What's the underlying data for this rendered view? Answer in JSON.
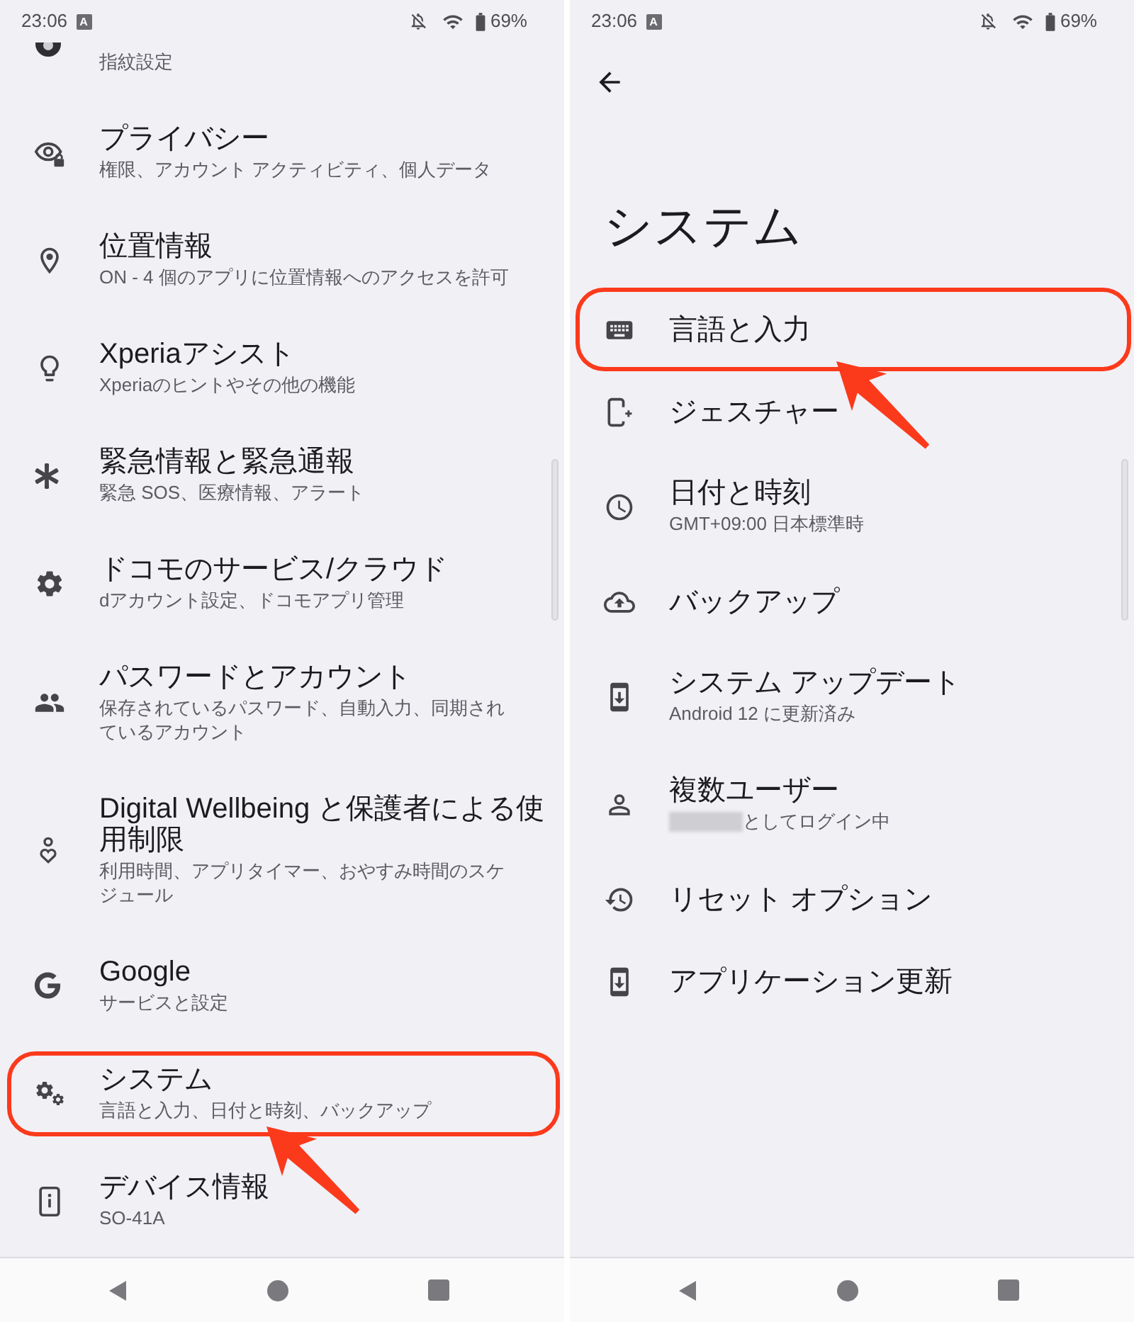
{
  "screens": [
    {
      "status_bar": {
        "time": "23:06",
        "notification_badge": "A",
        "battery_level": "69%"
      },
      "settings_items": [
        {
          "subtitle": "指紋設定",
          "highlighted": false
        },
        {
          "title": "プライバシー",
          "subtitle": "権限、アカウント アクティビティ、個人データ",
          "highlighted": false
        },
        {
          "title": "位置情報",
          "subtitle": "ON - 4 個のアプリに位置情報へのアクセスを許可",
          "highlighted": false
        },
        {
          "title": "Xperiaアシスト",
          "subtitle": "Xperiaのヒントやその他の機能",
          "highlighted": false
        },
        {
          "title": "緊急情報と緊急通報",
          "subtitle": "緊急 SOS、医療情報、アラート",
          "highlighted": false
        },
        {
          "title": "ドコモのサービス/クラウド",
          "subtitle": "dアカウント設定、ドコモアプリ管理",
          "highlighted": false
        },
        {
          "title": "パスワードとアカウント",
          "subtitle": [
            "保存されているパスワード、自動入力、同期され",
            "ているアカウント"
          ],
          "highlighted": false
        },
        {
          "title": [
            "Digital Wellbeing と保護者による使",
            "用制限"
          ],
          "subtitle": [
            "利用時間、アプリタイマー、おやすみ時間のスケ",
            "ジュール"
          ],
          "highlighted": false
        },
        {
          "title": "Google",
          "subtitle": "サービスと設定",
          "highlighted": false
        },
        {
          "title": "システム",
          "subtitle": "言語と入力、日付と時刻、バックアップ",
          "highlighted": true
        },
        {
          "title": "デバイス情報",
          "subtitle": "SO-41A",
          "highlighted": false
        }
      ]
    },
    {
      "status_bar": {
        "time": "23:06",
        "notification_badge": "A",
        "battery_level": "69%"
      },
      "page_title": "システム",
      "settings_items": [
        {
          "title": "言語と入力",
          "highlighted": true
        },
        {
          "title": "ジェスチャー",
          "highlighted": false
        },
        {
          "title": "日付と時刻",
          "subtitle": "GMT+09:00 日本標準時",
          "highlighted": false
        },
        {
          "title": "バックアップ",
          "highlighted": false
        },
        {
          "title": "システム アップデート",
          "subtitle": "Android 12 に更新済み",
          "highlighted": false
        },
        {
          "title": "複数ユーザー",
          "subtitle": "としてログイン中",
          "name_redacted": true,
          "highlighted": false
        },
        {
          "title": "リセット オプション",
          "highlighted": false
        },
        {
          "title": "アプリケーション更新",
          "highlighted": false
        }
      ]
    }
  ]
}
